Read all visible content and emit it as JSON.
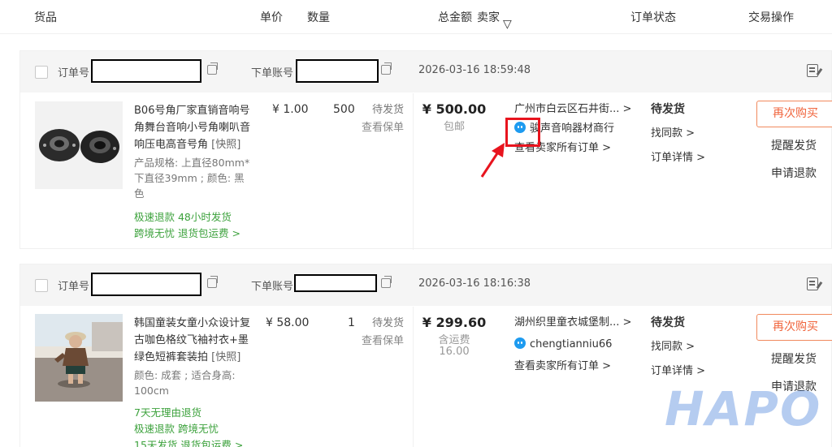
{
  "header": {
    "col_goods": "货品",
    "col_price": "单价",
    "col_qty": "数量",
    "col_total": "总金额",
    "col_seller": "卖家",
    "col_status": "订单状态",
    "col_action": "交易操作"
  },
  "orders": [
    {
      "order_no_label": "订单号",
      "account_label": "下单账号",
      "time": "2026-03-16 18:59:48",
      "title_line1": "B06号角厂家直销音响号",
      "title_line2": "角舞台音响小号角喇叭音",
      "title_line3": "响压电高音号角",
      "snapshot": "[快照]",
      "spec_line1": "产品规格: 上直径80mm*",
      "spec_line2": "下直径39mm ; 颜色: 黑",
      "spec_line3": "色",
      "tag_line1": "极速退款  48小时发货",
      "tag_line2": "跨境无忧  退货包运费 >",
      "price": "¥ 1.00",
      "qty": "500",
      "item_status": "待发货",
      "view_policy": "查看保单",
      "total": "¥ 500.00",
      "total_sub": "包邮",
      "seller_location": "广州市白云区石井街... >",
      "seller_name": "骏声音响器材商行",
      "seller_orders": "查看卖家所有订单 >",
      "order_status": "待发货",
      "find_similar": "找同款 >",
      "order_detail": "订单详情 >",
      "buy_again": "再次购买",
      "remind_ship": "提醒发货",
      "request_refund": "申请退款"
    },
    {
      "order_no_label": "订单号",
      "account_label": "下单账号",
      "time": "2026-03-16 18:16:38",
      "title_line1": "韩国童装女童小众设计复",
      "title_line2": "古咖色格纹飞袖衬衣+墨",
      "title_line3": "绿色短裤套装拍",
      "snapshot": "[快照]",
      "spec_line1": "颜色: 成套 ;  适合身高:",
      "spec_line2": "100cm",
      "tag_line1": "7天无理由退货",
      "tag_line2": "极速退款  跨境无忧",
      "tag_line3": "15天发货  退货包运费 >",
      "price": "¥ 58.00",
      "qty": "1",
      "item_status": "待发货",
      "view_policy": "查看保单",
      "total": "¥ 299.60",
      "total_sub": "含运费",
      "total_sub2": "16.00",
      "seller_location": "湖州织里童衣城堡制... >",
      "seller_name": "chengtianniu66",
      "seller_orders": "查看卖家所有订单 >",
      "order_status": "待发货",
      "find_similar": "找同款 >",
      "order_detail": "订单详情 >",
      "buy_again": "再次购买",
      "remind_ship": "提醒发货",
      "request_refund": "申请退款"
    }
  ],
  "watermark": "HAPO",
  "colors": {
    "accent_orange": "#f0643c",
    "tag_green": "#3da23d",
    "highlight_red": "#e8141e",
    "wangwang_blue": "#1e9bf0"
  },
  "icons": [
    "filter-icon",
    "copy-icon",
    "note-icon",
    "wangwang-icon",
    "arrow-icon"
  ]
}
